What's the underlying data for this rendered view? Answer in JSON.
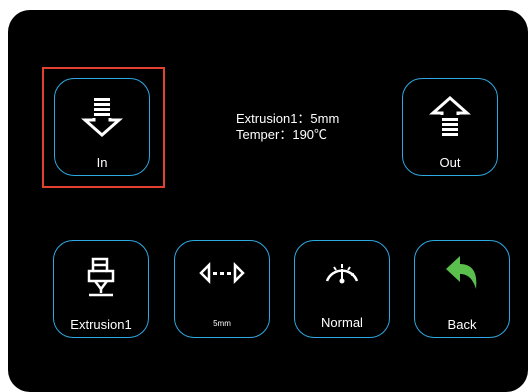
{
  "buttons": {
    "in": {
      "label": "In",
      "icon": "arrow-down-icon"
    },
    "out": {
      "label": "Out",
      "icon": "arrow-up-icon"
    },
    "extruder": {
      "label": "Extrusion1",
      "icon": "extruder-icon"
    },
    "step": {
      "label": "5mm",
      "icon": "distance-arrows-icon"
    },
    "speed": {
      "label": "Normal",
      "icon": "speedometer-icon"
    },
    "back": {
      "label": "Back",
      "icon": "back-arrow-icon"
    }
  },
  "status": {
    "extrusion": "Extrusion1：5mm",
    "temperature": "Temper：190℃"
  },
  "colors": {
    "accent": "#2ea8e0",
    "selection": "#e2412f",
    "back_arrow": "#5bbf4e",
    "background": "#000000"
  }
}
